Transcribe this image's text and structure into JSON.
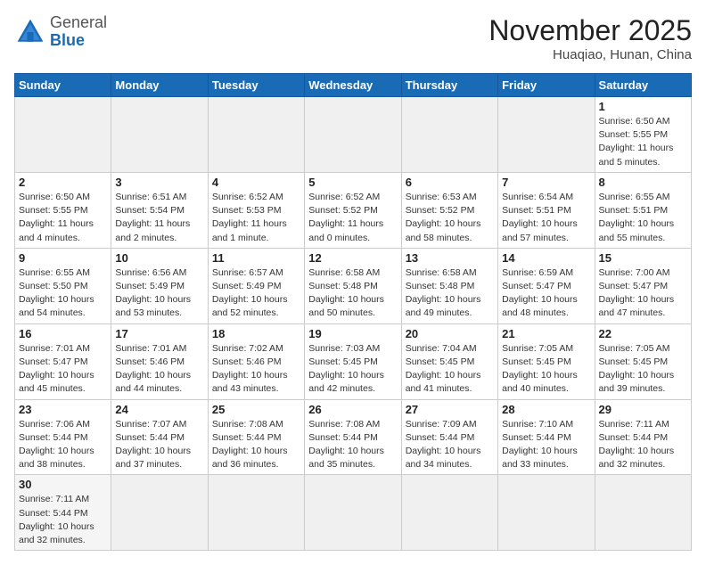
{
  "header": {
    "logo_general": "General",
    "logo_blue": "Blue",
    "month": "November 2025",
    "location": "Huaqiao, Hunan, China"
  },
  "weekdays": [
    "Sunday",
    "Monday",
    "Tuesday",
    "Wednesday",
    "Thursday",
    "Friday",
    "Saturday"
  ],
  "weeks": [
    [
      {
        "day": "",
        "info": ""
      },
      {
        "day": "",
        "info": ""
      },
      {
        "day": "",
        "info": ""
      },
      {
        "day": "",
        "info": ""
      },
      {
        "day": "",
        "info": ""
      },
      {
        "day": "",
        "info": ""
      },
      {
        "day": "1",
        "info": "Sunrise: 6:50 AM\nSunset: 5:55 PM\nDaylight: 11 hours\nand 5 minutes."
      }
    ],
    [
      {
        "day": "2",
        "info": "Sunrise: 6:50 AM\nSunset: 5:55 PM\nDaylight: 11 hours\nand 4 minutes."
      },
      {
        "day": "3",
        "info": "Sunrise: 6:51 AM\nSunset: 5:54 PM\nDaylight: 11 hours\nand 2 minutes."
      },
      {
        "day": "4",
        "info": "Sunrise: 6:52 AM\nSunset: 5:53 PM\nDaylight: 11 hours\nand 1 minute."
      },
      {
        "day": "5",
        "info": "Sunrise: 6:52 AM\nSunset: 5:52 PM\nDaylight: 11 hours\nand 0 minutes."
      },
      {
        "day": "6",
        "info": "Sunrise: 6:53 AM\nSunset: 5:52 PM\nDaylight: 10 hours\nand 58 minutes."
      },
      {
        "day": "7",
        "info": "Sunrise: 6:54 AM\nSunset: 5:51 PM\nDaylight: 10 hours\nand 57 minutes."
      },
      {
        "day": "8",
        "info": "Sunrise: 6:55 AM\nSunset: 5:51 PM\nDaylight: 10 hours\nand 55 minutes."
      }
    ],
    [
      {
        "day": "9",
        "info": "Sunrise: 6:55 AM\nSunset: 5:50 PM\nDaylight: 10 hours\nand 54 minutes."
      },
      {
        "day": "10",
        "info": "Sunrise: 6:56 AM\nSunset: 5:49 PM\nDaylight: 10 hours\nand 53 minutes."
      },
      {
        "day": "11",
        "info": "Sunrise: 6:57 AM\nSunset: 5:49 PM\nDaylight: 10 hours\nand 52 minutes."
      },
      {
        "day": "12",
        "info": "Sunrise: 6:58 AM\nSunset: 5:48 PM\nDaylight: 10 hours\nand 50 minutes."
      },
      {
        "day": "13",
        "info": "Sunrise: 6:58 AM\nSunset: 5:48 PM\nDaylight: 10 hours\nand 49 minutes."
      },
      {
        "day": "14",
        "info": "Sunrise: 6:59 AM\nSunset: 5:47 PM\nDaylight: 10 hours\nand 48 minutes."
      },
      {
        "day": "15",
        "info": "Sunrise: 7:00 AM\nSunset: 5:47 PM\nDaylight: 10 hours\nand 47 minutes."
      }
    ],
    [
      {
        "day": "16",
        "info": "Sunrise: 7:01 AM\nSunset: 5:47 PM\nDaylight: 10 hours\nand 45 minutes."
      },
      {
        "day": "17",
        "info": "Sunrise: 7:01 AM\nSunset: 5:46 PM\nDaylight: 10 hours\nand 44 minutes."
      },
      {
        "day": "18",
        "info": "Sunrise: 7:02 AM\nSunset: 5:46 PM\nDaylight: 10 hours\nand 43 minutes."
      },
      {
        "day": "19",
        "info": "Sunrise: 7:03 AM\nSunset: 5:45 PM\nDaylight: 10 hours\nand 42 minutes."
      },
      {
        "day": "20",
        "info": "Sunrise: 7:04 AM\nSunset: 5:45 PM\nDaylight: 10 hours\nand 41 minutes."
      },
      {
        "day": "21",
        "info": "Sunrise: 7:05 AM\nSunset: 5:45 PM\nDaylight: 10 hours\nand 40 minutes."
      },
      {
        "day": "22",
        "info": "Sunrise: 7:05 AM\nSunset: 5:45 PM\nDaylight: 10 hours\nand 39 minutes."
      }
    ],
    [
      {
        "day": "23",
        "info": "Sunrise: 7:06 AM\nSunset: 5:44 PM\nDaylight: 10 hours\nand 38 minutes."
      },
      {
        "day": "24",
        "info": "Sunrise: 7:07 AM\nSunset: 5:44 PM\nDaylight: 10 hours\nand 37 minutes."
      },
      {
        "day": "25",
        "info": "Sunrise: 7:08 AM\nSunset: 5:44 PM\nDaylight: 10 hours\nand 36 minutes."
      },
      {
        "day": "26",
        "info": "Sunrise: 7:08 AM\nSunset: 5:44 PM\nDaylight: 10 hours\nand 35 minutes."
      },
      {
        "day": "27",
        "info": "Sunrise: 7:09 AM\nSunset: 5:44 PM\nDaylight: 10 hours\nand 34 minutes."
      },
      {
        "day": "28",
        "info": "Sunrise: 7:10 AM\nSunset: 5:44 PM\nDaylight: 10 hours\nand 33 minutes."
      },
      {
        "day": "29",
        "info": "Sunrise: 7:11 AM\nSunset: 5:44 PM\nDaylight: 10 hours\nand 32 minutes."
      }
    ],
    [
      {
        "day": "30",
        "info": "Sunrise: 7:11 AM\nSunset: 5:44 PM\nDaylight: 10 hours\nand 32 minutes."
      },
      {
        "day": "",
        "info": ""
      },
      {
        "day": "",
        "info": ""
      },
      {
        "day": "",
        "info": ""
      },
      {
        "day": "",
        "info": ""
      },
      {
        "day": "",
        "info": ""
      },
      {
        "day": "",
        "info": ""
      }
    ]
  ]
}
